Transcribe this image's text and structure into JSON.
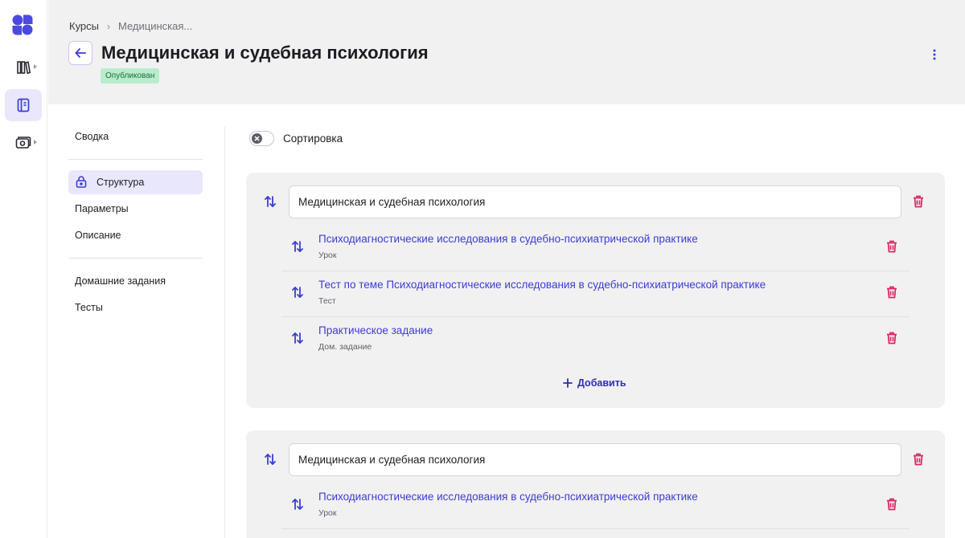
{
  "breadcrumb": {
    "root": "Курсы",
    "current": "Медицинская..."
  },
  "course": {
    "title": "Медицинская и судебная психология",
    "status": "Опубликован"
  },
  "sidebar_nav": [
    "library-icon",
    "course-icon",
    "media-icon"
  ],
  "menu": {
    "summary": "Сводка",
    "structure": "Структура",
    "params": "Параметры",
    "description": "Описание",
    "homework": "Домашние задания",
    "tests": "Тесты"
  },
  "sort_toggle": {
    "label": "Сортировка",
    "enabled": false
  },
  "sections": [
    {
      "name": "Медицинская и судебная психология",
      "add_label": "Добавить",
      "lessons": [
        {
          "title": "Психодиагностические исследования в судебно-психиатрической практике",
          "type": "Урок"
        },
        {
          "title": "Тест по теме Психодиагностические исследования в судебно-психиатрической практике",
          "type": "Тест"
        },
        {
          "title": "Практическое задание",
          "type": "Дом. задание"
        }
      ]
    },
    {
      "name": "Медицинская и судебная психология",
      "lessons": [
        {
          "title": "Психодиагностические исследования в судебно-психиатрической практике",
          "type": "Урок"
        }
      ]
    }
  ],
  "colors": {
    "accent": "#3c3cd6",
    "danger": "#e0245e",
    "badge_bg": "#b9eccd",
    "panel_bg": "#f1f1f2"
  }
}
